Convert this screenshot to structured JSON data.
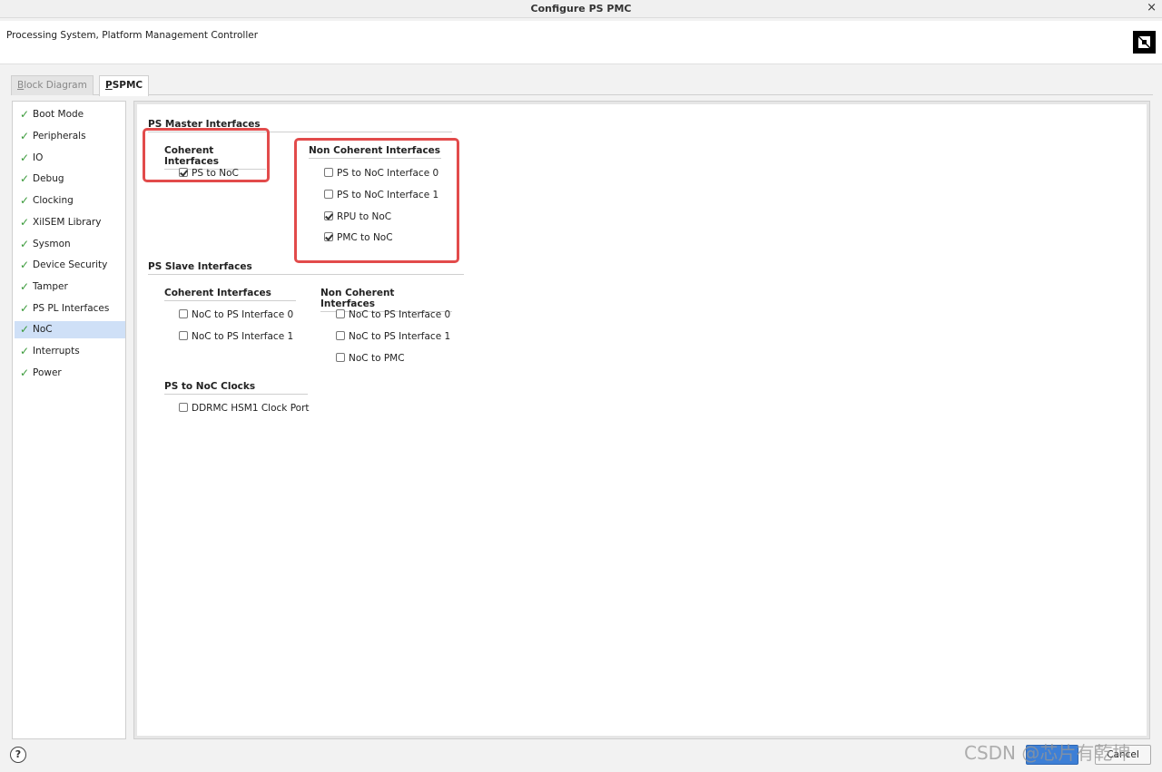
{
  "window": {
    "title": "Configure PS PMC",
    "close_glyph": "×"
  },
  "header": {
    "subtitle": "Processing System, Platform Management Controller",
    "logo": "amd-logo"
  },
  "tabs": [
    {
      "label": "Block Diagram",
      "mnemonic": "B",
      "rest": "lock Diagram",
      "active": false
    },
    {
      "label": "PSPMC",
      "mnemonic": "P",
      "rest": "SPMC",
      "active": true
    }
  ],
  "sidebar": {
    "items": [
      {
        "label": "Boot Mode"
      },
      {
        "label": "Peripherals"
      },
      {
        "label": "IO"
      },
      {
        "label": "Debug"
      },
      {
        "label": "Clocking"
      },
      {
        "label": "XilSEM Library"
      },
      {
        "label": "Sysmon"
      },
      {
        "label": "Device Security"
      },
      {
        "label": "Tamper"
      },
      {
        "label": "PS PL Interfaces"
      },
      {
        "label": "NoC",
        "selected": true
      },
      {
        "label": "Interrupts"
      },
      {
        "label": "Power"
      }
    ],
    "check_glyph": "✓",
    "check_color": "#3a9a3a"
  },
  "main": {
    "master": {
      "title": "PS Master Interfaces",
      "coherent": {
        "title": "Coherent Interfaces",
        "items": [
          {
            "label": "PS to NoC",
            "checked": true
          }
        ]
      },
      "non_coherent": {
        "title": "Non Coherent Interfaces",
        "items": [
          {
            "label": "PS to NoC Interface 0",
            "checked": false
          },
          {
            "label": "PS to NoC Interface 1",
            "checked": false
          },
          {
            "label": "RPU to NoC",
            "checked": true
          },
          {
            "label": "PMC to NoC",
            "checked": true
          }
        ]
      }
    },
    "slave": {
      "title": "PS Slave Interfaces",
      "coherent": {
        "title": "Coherent Interfaces",
        "items": [
          {
            "label": "NoC to PS Interface 0",
            "checked": false
          },
          {
            "label": "NoC to PS Interface 1",
            "checked": false
          }
        ]
      },
      "non_coherent": {
        "title": "Non Coherent Interfaces",
        "items": [
          {
            "label": "NoC to PS Interface 0",
            "checked": false
          },
          {
            "label": "NoC to PS Interface 1",
            "checked": false
          },
          {
            "label": "NoC to PMC",
            "checked": false
          }
        ]
      }
    },
    "clocks": {
      "title": "PS to NoC Clocks",
      "items": [
        {
          "label": "DDRMC HSM1 Clock Port",
          "checked": false
        }
      ]
    },
    "highlight_color": "#e24b4b"
  },
  "footer": {
    "help_glyph": "?",
    "ok_label": "",
    "cancel_label": "Cancel",
    "watermark": "CSDN @芯片有乾坤"
  }
}
